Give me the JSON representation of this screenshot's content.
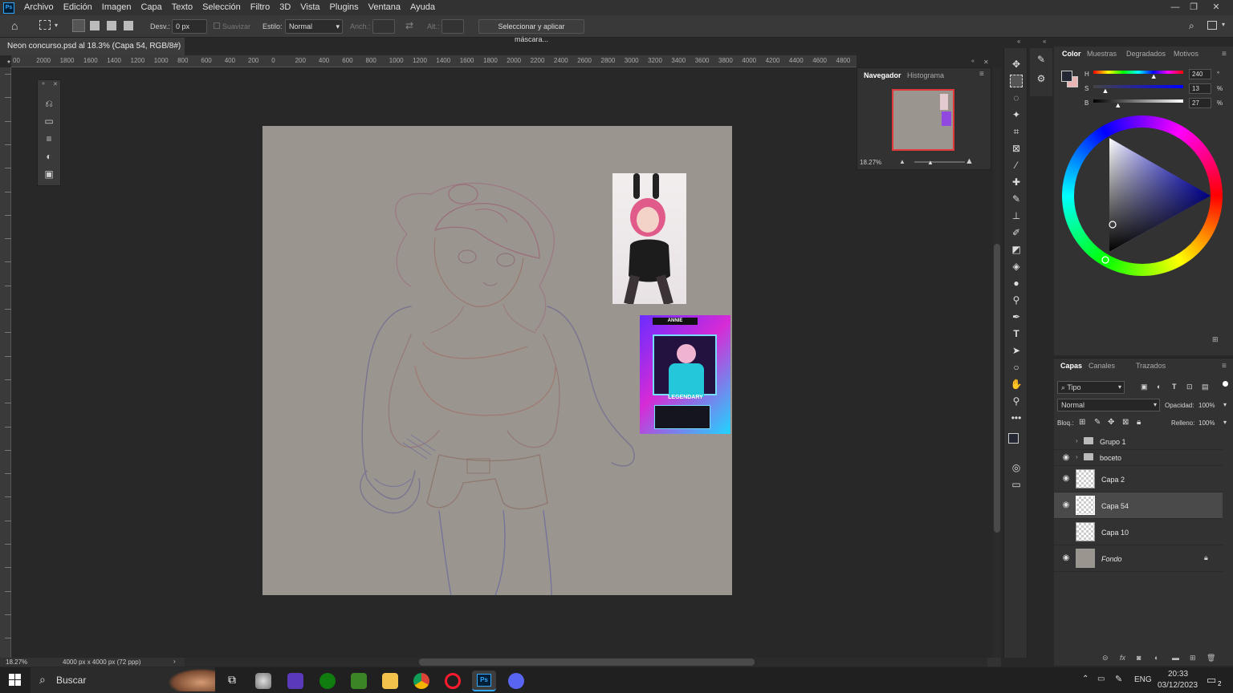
{
  "app": {
    "logo": "Ps"
  },
  "menu": [
    "Archivo",
    "Edición",
    "Imagen",
    "Capa",
    "Texto",
    "Selección",
    "Filtro",
    "3D",
    "Vista",
    "Plugins",
    "Ventana",
    "Ayuda"
  ],
  "options": {
    "feather_label": "Desv.:",
    "feather_value": "0 px",
    "smooth_label": "Suavizar",
    "style_label": "Estilo:",
    "style_value": "Normal",
    "width_label": "Anch.:",
    "height_label": "Alt.:",
    "mask_button": "Seleccionar y aplicar máscara..."
  },
  "document": {
    "tab_title": "Neon concurso.psd al 18.3% (Capa 54, RGB/8#) *",
    "close": "×"
  },
  "ruler": [
    "00",
    "2000",
    "1800",
    "1600",
    "1400",
    "1200",
    "1000",
    "800",
    "600",
    "400",
    "200",
    "0",
    "200",
    "400",
    "600",
    "800",
    "1000",
    "1200",
    "1400",
    "1600",
    "1800",
    "2000",
    "2200",
    "2400",
    "2600",
    "2800",
    "3000",
    "3200",
    "3400",
    "3600",
    "3800",
    "4000",
    "4200",
    "4400",
    "4600",
    "4800",
    "5("
  ],
  "reference": {
    "card_name": "ANNIE",
    "card_title": "LEGENDARY"
  },
  "navigator": {
    "tab1": "Navegador",
    "tab2": "Histograma",
    "zoom": "18.27%"
  },
  "color_panel": {
    "tabs": [
      "Color",
      "Muestras",
      "Degradados",
      "Motivos"
    ],
    "h_label": "H",
    "h_value": "240",
    "h_unit": "°",
    "s_label": "S",
    "s_value": "13",
    "s_unit": "%",
    "b_label": "B",
    "b_value": "27",
    "b_unit": "%",
    "h_fraction": 0.667,
    "s_fraction": 0.13,
    "b_fraction": 0.27
  },
  "layers_panel": {
    "tabs": [
      "Capas",
      "Canales",
      "Trazados"
    ],
    "filter": "Tipo",
    "blend_mode": "Normal",
    "opacity_label": "Opacidad:",
    "opacity_value": "100%",
    "lock_label": "Bloq.:",
    "fill_label": "Relleno:",
    "fill_value": "100%",
    "layers": [
      {
        "name": "Grupo 1",
        "visible": false,
        "type": "group"
      },
      {
        "name": "boceto",
        "visible": true,
        "type": "group"
      },
      {
        "name": "Capa 2",
        "visible": true,
        "type": "layer"
      },
      {
        "name": "Capa 54",
        "visible": true,
        "type": "layer",
        "selected": true
      },
      {
        "name": "Capa 10",
        "visible": false,
        "type": "layer"
      },
      {
        "name": "Fondo",
        "visible": true,
        "type": "background",
        "locked": true
      }
    ]
  },
  "status": {
    "zoom": "18.27%",
    "doc_size": "4000 px x 4000 px (72 ppp)"
  },
  "taskbar": {
    "search": "Buscar",
    "lang": "ENG",
    "time": "20:33",
    "date": "03/12/2023",
    "notifications": "2"
  },
  "colors": {
    "accent": "#31a8ff",
    "canvas": "#9a968f",
    "nav_frame": "#e23a3a"
  }
}
